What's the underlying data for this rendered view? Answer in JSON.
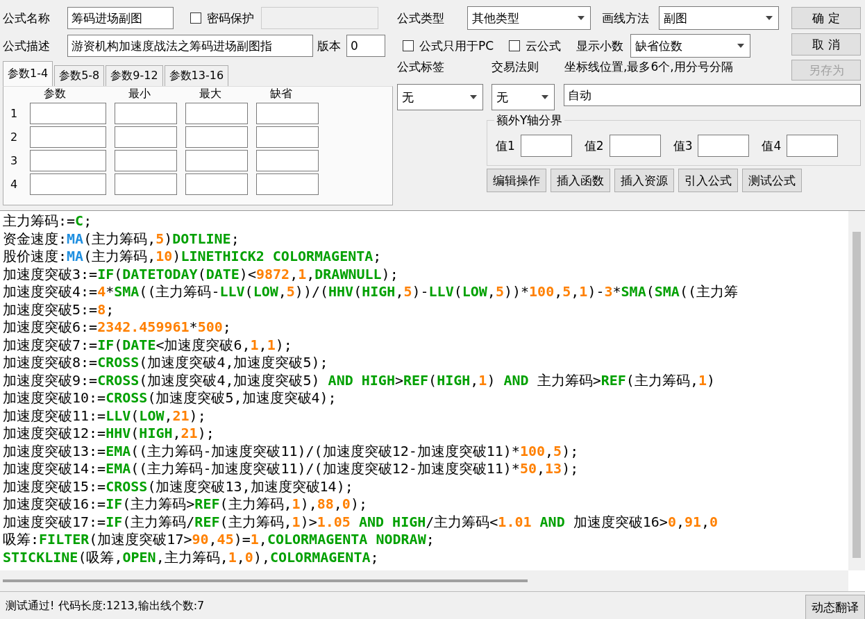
{
  "formula_name": {
    "label": "公式名称",
    "value": "筹码进场副图"
  },
  "password": {
    "label": "密码保护",
    "checked": false
  },
  "description": {
    "label": "公式描述",
    "value": "游资机构加速度战法之筹码进场副图指"
  },
  "version": {
    "label": "版本",
    "value": "0"
  },
  "param_tabs": [
    {
      "label": "参数1-4",
      "selected": true
    },
    {
      "label": "参数5-8",
      "selected": false
    },
    {
      "label": "参数9-12",
      "selected": false
    },
    {
      "label": "参数13-16",
      "selected": false
    }
  ],
  "param_table": {
    "columns": [
      "参数",
      "最小",
      "最大",
      "缺省"
    ],
    "rows": [
      "1",
      "2",
      "3",
      "4"
    ]
  },
  "formula_type": {
    "label": "公式类型",
    "value": "其他类型"
  },
  "draw_method": {
    "label": "画线方法",
    "value": "副图"
  },
  "pc_only": {
    "label": "公式只用于PC",
    "checked": false
  },
  "cloud": {
    "label": "云公式",
    "checked": false
  },
  "decimals": {
    "label": "显示小数",
    "value": "缺省位数"
  },
  "buttons": [
    {
      "label": "确 定",
      "disabled": false
    },
    {
      "label": "取 消",
      "disabled": false
    },
    {
      "label": "另存为",
      "disabled": true
    }
  ],
  "formula_tag": {
    "label": "公式标签",
    "value": "无"
  },
  "trade_rule": {
    "label": "交易法则",
    "value": "无"
  },
  "axis_lines": {
    "label": "坐标线位置,最多6个,用分号分隔",
    "value": "自动"
  },
  "y_axis_group": {
    "title": "额外Y轴分界",
    "fields": [
      "值1",
      "值2",
      "值3",
      "值4"
    ]
  },
  "action_buttons": [
    "编辑操作",
    "插入函数",
    "插入资源",
    "引入公式",
    "测试公式"
  ],
  "code_lines": [
    [
      {
        "text": "主力筹码:=",
        "kind": "plain"
      },
      {
        "text": "C",
        "kind": "func"
      },
      {
        "text": ";",
        "kind": "plain"
      }
    ],
    [
      {
        "text": "资金速度:",
        "kind": "plain"
      },
      {
        "text": "MA",
        "kind": "builtin"
      },
      {
        "text": "(主力筹码,",
        "kind": "plain"
      },
      {
        "text": "5",
        "kind": "number"
      },
      {
        "text": ")",
        "kind": "plain"
      },
      {
        "text": "DOTLINE",
        "kind": "func"
      },
      {
        "text": ";",
        "kind": "plain"
      }
    ],
    [
      {
        "text": "股价速度:",
        "kind": "plain"
      },
      {
        "text": "MA",
        "kind": "builtin"
      },
      {
        "text": "(主力筹码,",
        "kind": "plain"
      },
      {
        "text": "10",
        "kind": "number"
      },
      {
        "text": ")",
        "kind": "plain"
      },
      {
        "text": "LINETHICK2 COLORMAGENTA",
        "kind": "func"
      },
      {
        "text": ";",
        "kind": "plain"
      }
    ],
    [
      {
        "text": "加速度突破3:=",
        "kind": "plain"
      },
      {
        "text": "IF",
        "kind": "func"
      },
      {
        "text": "(",
        "kind": "plain"
      },
      {
        "text": "DATETODAY",
        "kind": "func"
      },
      {
        "text": "(",
        "kind": "plain"
      },
      {
        "text": "DATE",
        "kind": "func"
      },
      {
        "text": ")<",
        "kind": "plain"
      },
      {
        "text": "9872",
        "kind": "number"
      },
      {
        "text": ",",
        "kind": "plain"
      },
      {
        "text": "1",
        "kind": "number"
      },
      {
        "text": ",",
        "kind": "plain"
      },
      {
        "text": "DRAWNULL",
        "kind": "func"
      },
      {
        "text": ");",
        "kind": "plain"
      }
    ],
    [
      {
        "text": "加速度突破4:=",
        "kind": "plain"
      },
      {
        "text": "4",
        "kind": "number"
      },
      {
        "text": "*",
        "kind": "plain"
      },
      {
        "text": "SMA",
        "kind": "func"
      },
      {
        "text": "((主力筹码-",
        "kind": "plain"
      },
      {
        "text": "LLV",
        "kind": "func"
      },
      {
        "text": "(",
        "kind": "plain"
      },
      {
        "text": "LOW",
        "kind": "func"
      },
      {
        "text": ",",
        "kind": "plain"
      },
      {
        "text": "5",
        "kind": "number"
      },
      {
        "text": "))/(",
        "kind": "plain"
      },
      {
        "text": "HHV",
        "kind": "func"
      },
      {
        "text": "(",
        "kind": "plain"
      },
      {
        "text": "HIGH",
        "kind": "func"
      },
      {
        "text": ",",
        "kind": "plain"
      },
      {
        "text": "5",
        "kind": "number"
      },
      {
        "text": ")-",
        "kind": "plain"
      },
      {
        "text": "LLV",
        "kind": "func"
      },
      {
        "text": "(",
        "kind": "plain"
      },
      {
        "text": "LOW",
        "kind": "func"
      },
      {
        "text": ",",
        "kind": "plain"
      },
      {
        "text": "5",
        "kind": "number"
      },
      {
        "text": "))*",
        "kind": "plain"
      },
      {
        "text": "100",
        "kind": "number"
      },
      {
        "text": ",",
        "kind": "plain"
      },
      {
        "text": "5",
        "kind": "number"
      },
      {
        "text": ",",
        "kind": "plain"
      },
      {
        "text": "1",
        "kind": "number"
      },
      {
        "text": ")-",
        "kind": "plain"
      },
      {
        "text": "3",
        "kind": "number"
      },
      {
        "text": "*",
        "kind": "plain"
      },
      {
        "text": "SMA",
        "kind": "func"
      },
      {
        "text": "(",
        "kind": "plain"
      },
      {
        "text": "SMA",
        "kind": "func"
      },
      {
        "text": "((主力筹",
        "kind": "plain"
      }
    ],
    [
      {
        "text": "加速度突破5:=",
        "kind": "plain"
      },
      {
        "text": "8",
        "kind": "number"
      },
      {
        "text": ";",
        "kind": "plain"
      }
    ],
    [
      {
        "text": "加速度突破6:=",
        "kind": "plain"
      },
      {
        "text": "2342.459961",
        "kind": "number"
      },
      {
        "text": "*",
        "kind": "plain"
      },
      {
        "text": "500",
        "kind": "number"
      },
      {
        "text": ";",
        "kind": "plain"
      }
    ],
    [
      {
        "text": "加速度突破7:=",
        "kind": "plain"
      },
      {
        "text": "IF",
        "kind": "func"
      },
      {
        "text": "(",
        "kind": "plain"
      },
      {
        "text": "DATE",
        "kind": "func"
      },
      {
        "text": "<加速度突破6,",
        "kind": "plain"
      },
      {
        "text": "1",
        "kind": "number"
      },
      {
        "text": ",",
        "kind": "plain"
      },
      {
        "text": "1",
        "kind": "number"
      },
      {
        "text": ");",
        "kind": "plain"
      }
    ],
    [
      {
        "text": "加速度突破8:=",
        "kind": "plain"
      },
      {
        "text": "CROSS",
        "kind": "func"
      },
      {
        "text": "(加速度突破4,加速度突破5);",
        "kind": "plain"
      }
    ],
    [
      {
        "text": "加速度突破9:=",
        "kind": "plain"
      },
      {
        "text": "CROSS",
        "kind": "func"
      },
      {
        "text": "(加速度突破4,加速度突破5) ",
        "kind": "plain"
      },
      {
        "text": "AND HIGH",
        "kind": "func"
      },
      {
        "text": ">",
        "kind": "plain"
      },
      {
        "text": "REF",
        "kind": "func"
      },
      {
        "text": "(",
        "kind": "plain"
      },
      {
        "text": "HIGH",
        "kind": "func"
      },
      {
        "text": ",",
        "kind": "plain"
      },
      {
        "text": "1",
        "kind": "number"
      },
      {
        "text": ") ",
        "kind": "plain"
      },
      {
        "text": "AND",
        "kind": "func"
      },
      {
        "text": " 主力筹码>",
        "kind": "plain"
      },
      {
        "text": "REF",
        "kind": "func"
      },
      {
        "text": "(主力筹码,",
        "kind": "plain"
      },
      {
        "text": "1",
        "kind": "number"
      },
      {
        "text": ")",
        "kind": "plain"
      }
    ],
    [
      {
        "text": "加速度突破10:=",
        "kind": "plain"
      },
      {
        "text": "CROSS",
        "kind": "func"
      },
      {
        "text": "(加速度突破5,加速度突破4);",
        "kind": "plain"
      }
    ],
    [
      {
        "text": "加速度突破11:=",
        "kind": "plain"
      },
      {
        "text": "LLV",
        "kind": "func"
      },
      {
        "text": "(",
        "kind": "plain"
      },
      {
        "text": "LOW",
        "kind": "func"
      },
      {
        "text": ",",
        "kind": "plain"
      },
      {
        "text": "21",
        "kind": "number"
      },
      {
        "text": ");",
        "kind": "plain"
      }
    ],
    [
      {
        "text": "加速度突破12:=",
        "kind": "plain"
      },
      {
        "text": "HHV",
        "kind": "func"
      },
      {
        "text": "(",
        "kind": "plain"
      },
      {
        "text": "HIGH",
        "kind": "func"
      },
      {
        "text": ",",
        "kind": "plain"
      },
      {
        "text": "21",
        "kind": "number"
      },
      {
        "text": ");",
        "kind": "plain"
      }
    ],
    [
      {
        "text": "加速度突破13:=",
        "kind": "plain"
      },
      {
        "text": "EMA",
        "kind": "func"
      },
      {
        "text": "((主力筹码-加速度突破11)/(加速度突破12-加速度突破11)*",
        "kind": "plain"
      },
      {
        "text": "100",
        "kind": "number"
      },
      {
        "text": ",",
        "kind": "plain"
      },
      {
        "text": "5",
        "kind": "number"
      },
      {
        "text": ");",
        "kind": "plain"
      }
    ],
    [
      {
        "text": "加速度突破14:=",
        "kind": "plain"
      },
      {
        "text": "EMA",
        "kind": "func"
      },
      {
        "text": "((主力筹码-加速度突破11)/(加速度突破12-加速度突破11)*",
        "kind": "plain"
      },
      {
        "text": "50",
        "kind": "number"
      },
      {
        "text": ",",
        "kind": "plain"
      },
      {
        "text": "13",
        "kind": "number"
      },
      {
        "text": ");",
        "kind": "plain"
      }
    ],
    [
      {
        "text": "加速度突破15:=",
        "kind": "plain"
      },
      {
        "text": "CROSS",
        "kind": "func"
      },
      {
        "text": "(加速度突破13,加速度突破14);",
        "kind": "plain"
      }
    ],
    [
      {
        "text": "加速度突破16:=",
        "kind": "plain"
      },
      {
        "text": "IF",
        "kind": "func"
      },
      {
        "text": "(主力筹码>",
        "kind": "plain"
      },
      {
        "text": "REF",
        "kind": "func"
      },
      {
        "text": "(主力筹码,",
        "kind": "plain"
      },
      {
        "text": "1",
        "kind": "number"
      },
      {
        "text": "),",
        "kind": "plain"
      },
      {
        "text": "88",
        "kind": "number"
      },
      {
        "text": ",",
        "kind": "plain"
      },
      {
        "text": "0",
        "kind": "number"
      },
      {
        "text": ");",
        "kind": "plain"
      }
    ],
    [
      {
        "text": "加速度突破17:=",
        "kind": "plain"
      },
      {
        "text": "IF",
        "kind": "func"
      },
      {
        "text": "(主力筹码/",
        "kind": "plain"
      },
      {
        "text": "REF",
        "kind": "func"
      },
      {
        "text": "(主力筹码,",
        "kind": "plain"
      },
      {
        "text": "1",
        "kind": "number"
      },
      {
        "text": ")>",
        "kind": "plain"
      },
      {
        "text": "1.05",
        "kind": "number"
      },
      {
        "text": " AND HIGH",
        "kind": "func"
      },
      {
        "text": "/主力筹码<",
        "kind": "plain"
      },
      {
        "text": "1.01",
        "kind": "number"
      },
      {
        "text": " AND",
        "kind": "func"
      },
      {
        "text": " 加速度突破16>",
        "kind": "plain"
      },
      {
        "text": "0",
        "kind": "number"
      },
      {
        "text": ",",
        "kind": "plain"
      },
      {
        "text": "91",
        "kind": "number"
      },
      {
        "text": ",",
        "kind": "plain"
      },
      {
        "text": "0",
        "kind": "number"
      }
    ],
    [
      {
        "text": "吸筹:",
        "kind": "plain"
      },
      {
        "text": "FILTER",
        "kind": "func"
      },
      {
        "text": "(加速度突破17>",
        "kind": "plain"
      },
      {
        "text": "90",
        "kind": "number"
      },
      {
        "text": ",",
        "kind": "plain"
      },
      {
        "text": "45",
        "kind": "number"
      },
      {
        "text": ")=",
        "kind": "plain"
      },
      {
        "text": "1",
        "kind": "number"
      },
      {
        "text": ",",
        "kind": "plain"
      },
      {
        "text": "COLORMAGENTA NODRAW",
        "kind": "func"
      },
      {
        "text": ";",
        "kind": "plain"
      }
    ],
    [
      {
        "text": "STICKLINE",
        "kind": "func"
      },
      {
        "text": "(吸筹,",
        "kind": "plain"
      },
      {
        "text": "OPEN",
        "kind": "func"
      },
      {
        "text": ",主力筹码,",
        "kind": "plain"
      },
      {
        "text": "1",
        "kind": "number"
      },
      {
        "text": ",",
        "kind": "plain"
      },
      {
        "text": "0",
        "kind": "number"
      },
      {
        "text": "),",
        "kind": "plain"
      },
      {
        "text": "COLORMAGENTA",
        "kind": "func"
      },
      {
        "text": ";",
        "kind": "plain"
      }
    ]
  ],
  "status": "测试通过! 代码长度:1213,输出线个数:7",
  "translate_button": "动态翻译"
}
